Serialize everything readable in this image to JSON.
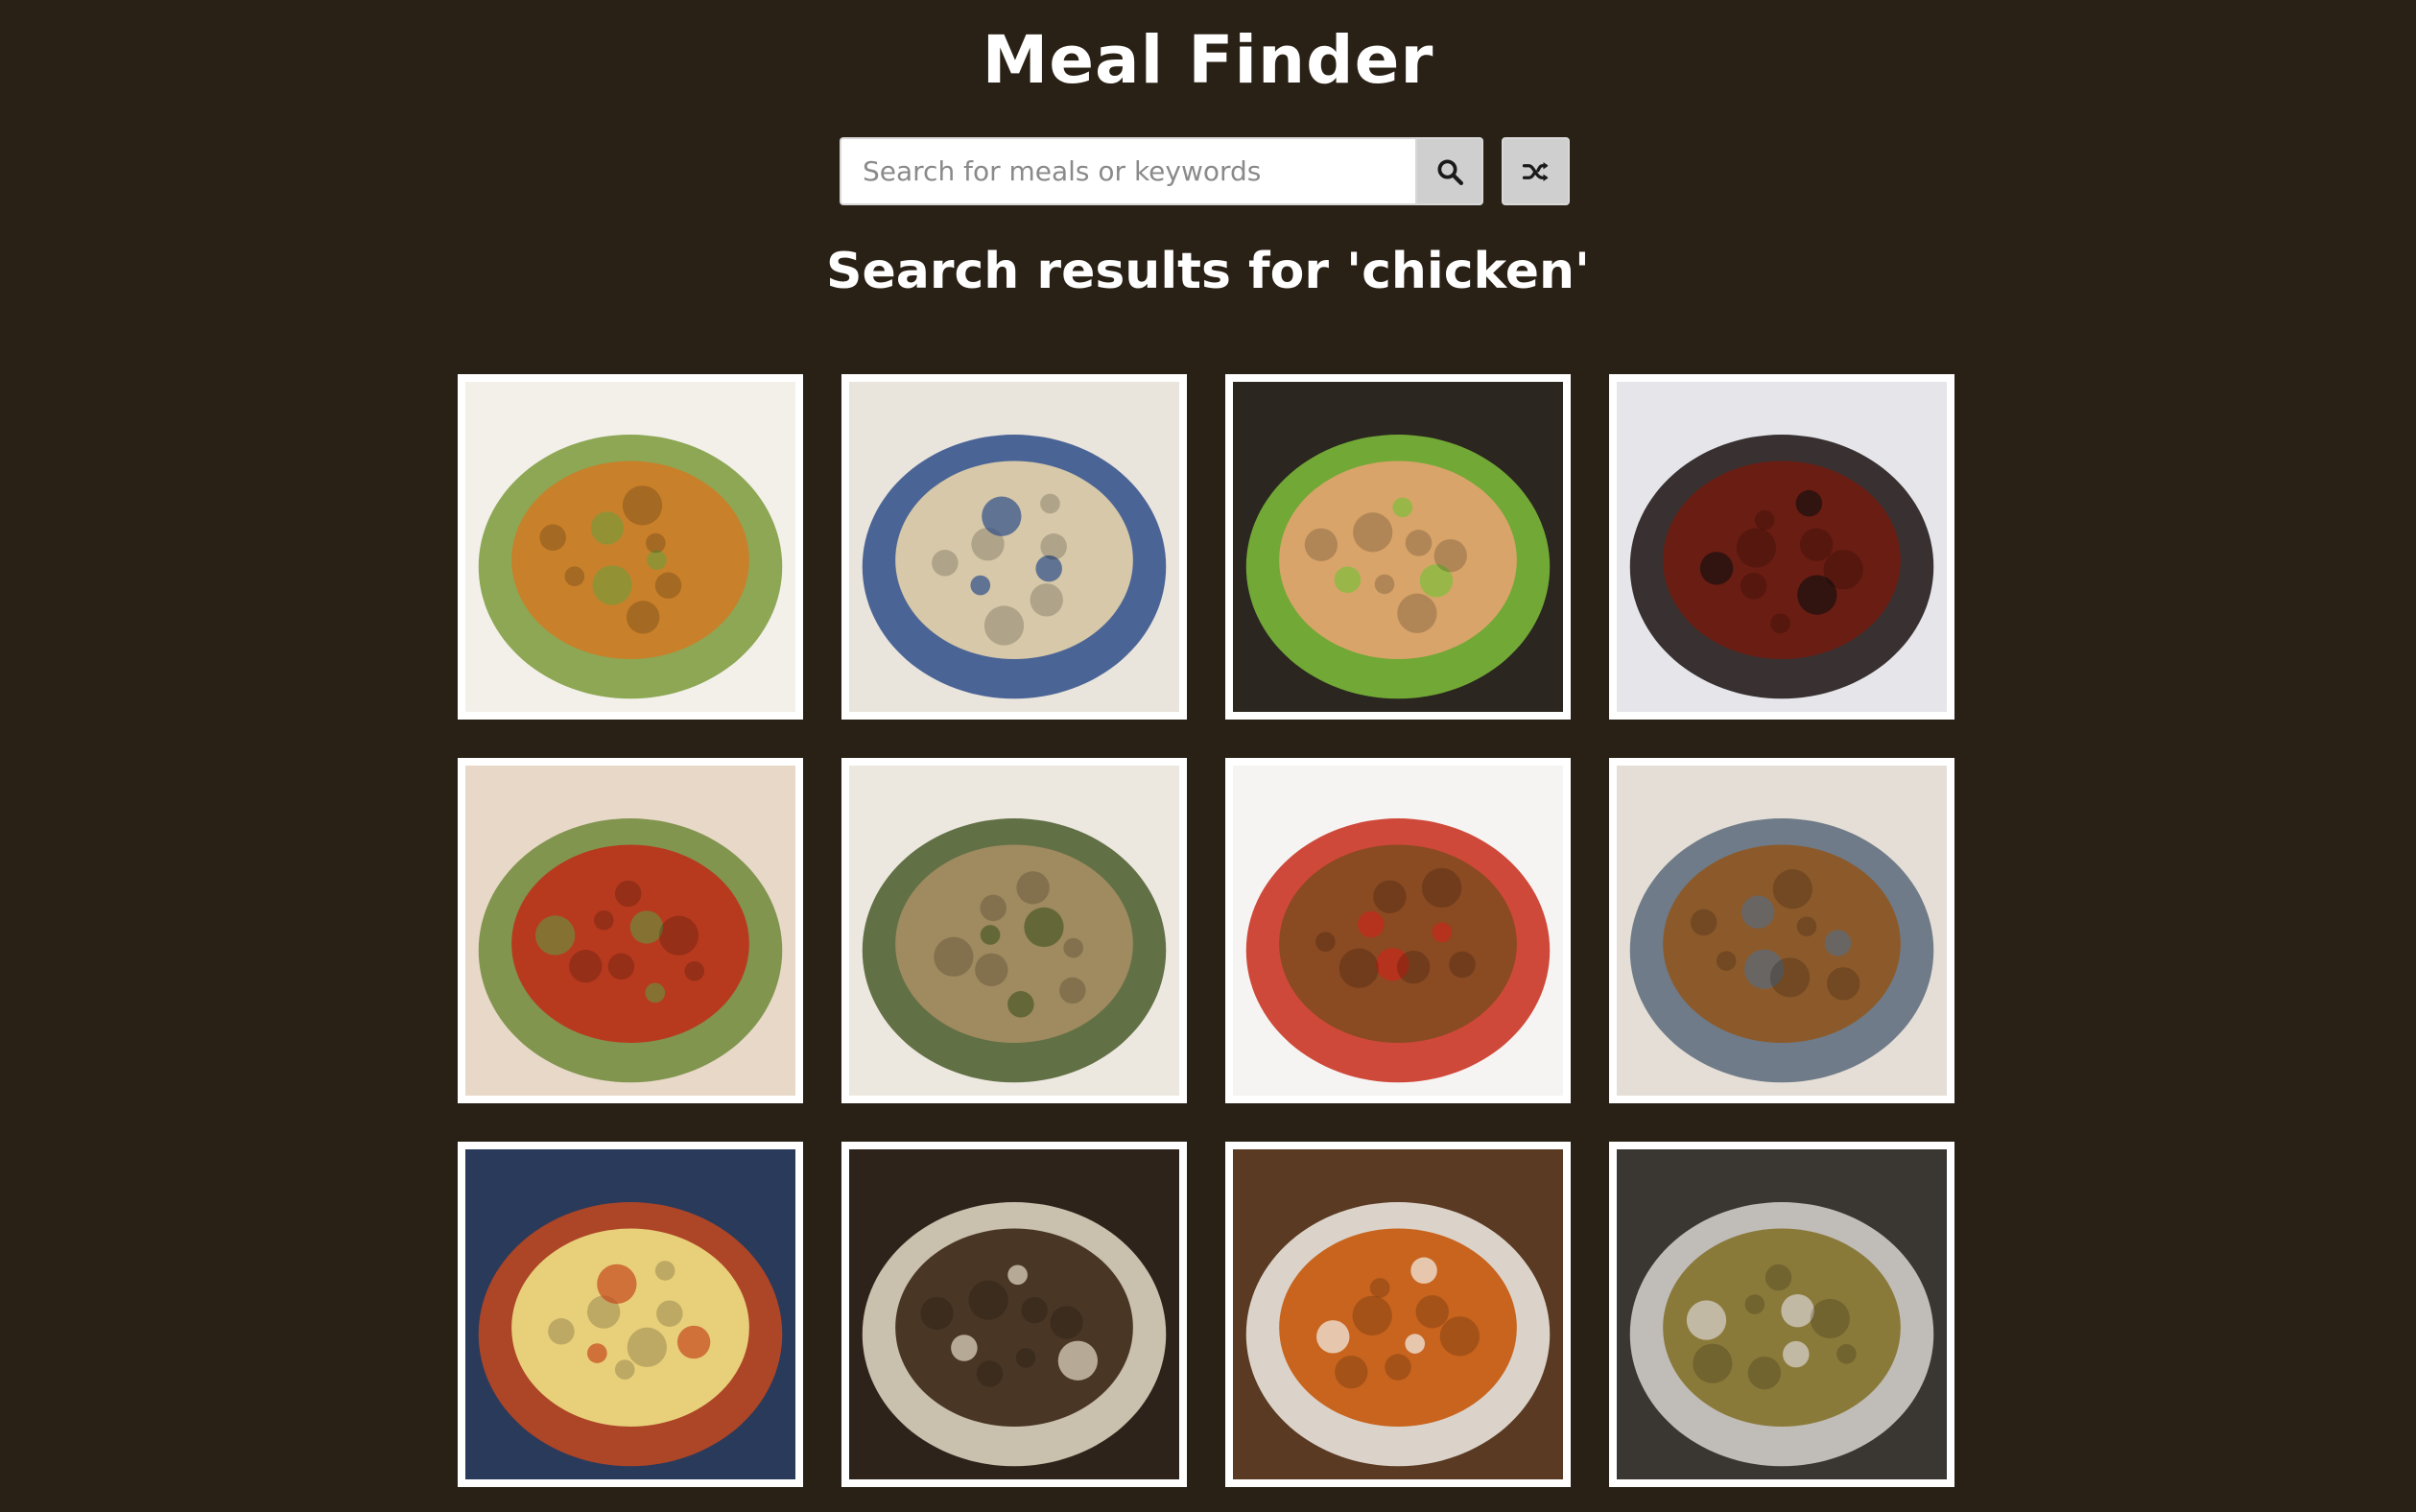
{
  "app": {
    "title": "Meal Finder"
  },
  "search": {
    "placeholder": "Search for meals or keywords",
    "value": "",
    "search_icon": "search-icon",
    "random_icon": "shuffle-icon"
  },
  "results": {
    "heading": "Search results for 'chicken'"
  },
  "meals": [
    {
      "image": "chicken-curry-plate",
      "colors": [
        "#f3f0ea",
        "#c9802a",
        "#7a9a3a"
      ]
    },
    {
      "image": "rice-porridge-bowl",
      "colors": [
        "#e9e4dc",
        "#d6c8a8",
        "#2f4e8a"
      ]
    },
    {
      "image": "chicken-lettuce-board",
      "colors": [
        "#2b2620",
        "#d8a46a",
        "#7fbf3a"
      ]
    },
    {
      "image": "braised-chicken-pot",
      "colors": [
        "#e6e6ea",
        "#6a1d12",
        "#1a1010"
      ]
    },
    {
      "image": "tandoori-chicken",
      "colors": [
        "#e8d8c8",
        "#b83a1e",
        "#6f8a3a"
      ]
    },
    {
      "image": "chicken-couscous-plate",
      "colors": [
        "#ece8e0",
        "#a08a60",
        "#4a5a2a"
      ]
    },
    {
      "image": "kung-pao-chicken",
      "colors": [
        "#f6f4f2",
        "#8a4a22",
        "#c82a1a"
      ]
    },
    {
      "image": "chicken-casserole-pan",
      "colors": [
        "#e4ded6",
        "#8c5a2a",
        "#5a6a7a"
      ]
    },
    {
      "image": "chicken-pie-dish",
      "colors": [
        "#2a3a5a",
        "#e8cf7a",
        "#c4481e"
      ]
    },
    {
      "image": "chicken-adobo-bowl",
      "colors": [
        "#2e231a",
        "#4a3624",
        "#e4dcc8"
      ]
    },
    {
      "image": "katsu-curry-plate",
      "colors": [
        "#5a3a22",
        "#c8641e",
        "#f2efe8"
      ]
    },
    {
      "image": "chicken-stew-pan",
      "colors": [
        "#3a3632",
        "#8a7a3a",
        "#d8d4d0"
      ]
    }
  ]
}
